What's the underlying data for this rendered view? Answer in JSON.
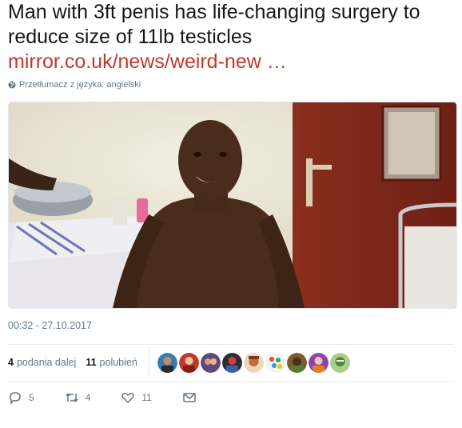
{
  "tweet": {
    "text": "Man with 3ft penis has life-changing surgery to reduce size of 11lb testicles",
    "link": "mirror.co.uk/news/weird-new …",
    "translate_label": "Przetłumacz z języka: angielski",
    "timestamp": "00:32 - 27.10.2017",
    "link_color": "#c0392b"
  },
  "stats": {
    "retweets_count": "4",
    "retweets_label": "podania dalej",
    "likes_count": "11",
    "likes_label": "polubień",
    "avatar_count": 9
  },
  "actions": {
    "reply_count": "5",
    "retweet_count": "4",
    "like_count": "11"
  },
  "icons": [
    "globe-icon",
    "reply-icon",
    "retweet-icon",
    "heart-icon",
    "mail-icon"
  ]
}
